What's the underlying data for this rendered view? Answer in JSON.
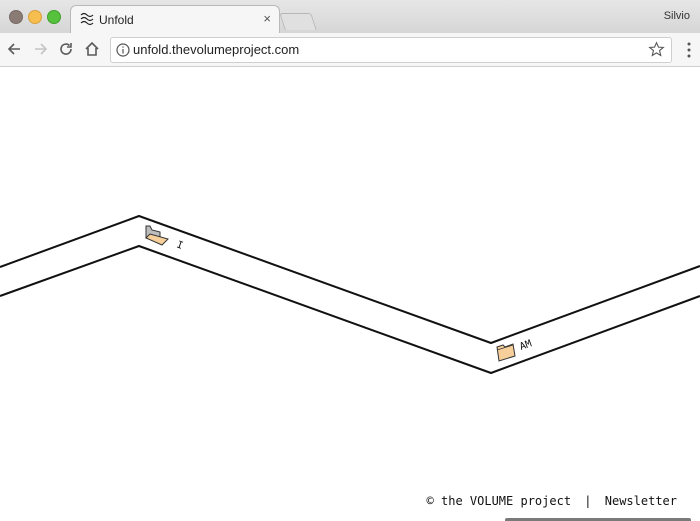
{
  "window": {
    "profile_name": "Silvio"
  },
  "tab": {
    "title": "Unfold",
    "close_glyph": "×",
    "icon": "waves-icon"
  },
  "toolbar": {
    "url": "unfold.thevolumeproject.com",
    "icons": [
      "back-arrow-icon",
      "forward-arrow-icon",
      "reload-icon",
      "home-icon",
      "info-icon",
      "bookmark-star-icon",
      "menu-dots-icon"
    ]
  },
  "content": {
    "folders": [
      {
        "label": "I",
        "state": "open"
      },
      {
        "label": "AM",
        "state": "closed"
      }
    ],
    "colors": {
      "folder_fill": "#f6cf9a",
      "folder_open_back": "#bdbdbd",
      "line": "#111111"
    }
  },
  "footer": {
    "copyright": "© the VOLUME project",
    "separator": "|",
    "newsletter": "Newsletter"
  }
}
